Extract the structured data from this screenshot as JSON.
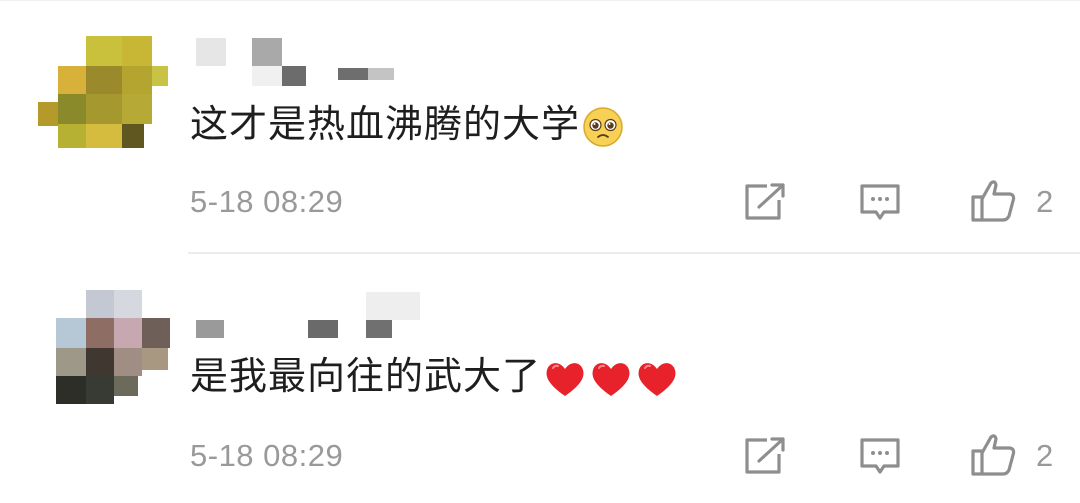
{
  "comments": [
    {
      "text": "这才是热血沸腾的大学",
      "emoji": "pleading-face",
      "time": "5-18 08:29",
      "like_count": "2",
      "icons": [
        "share-icon",
        "comment-icon",
        "like-icon"
      ]
    },
    {
      "text": "是我最向往的武大了",
      "emoji": "red-heart x3",
      "time": "5-18 08:29",
      "like_count": "2",
      "icons": [
        "share-icon",
        "comment-icon",
        "like-icon"
      ]
    }
  ],
  "colors": {
    "text": "#1e1e1e",
    "meta": "#999999",
    "icon": "#8e8e8e",
    "heart": "#e8222b",
    "divider": "#ececec"
  }
}
